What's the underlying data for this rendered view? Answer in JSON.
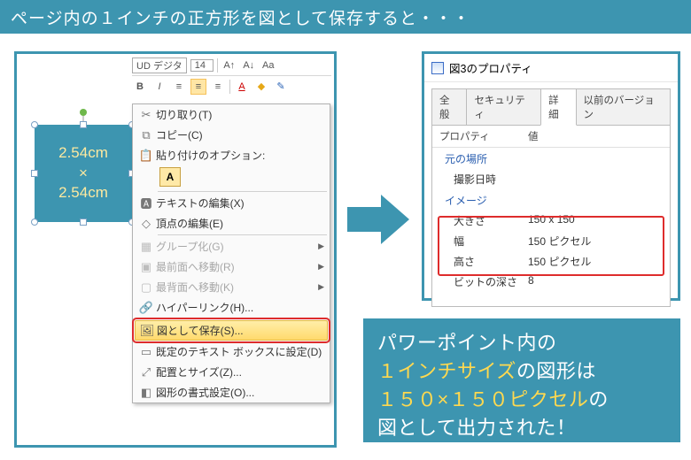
{
  "title": "ページ内の１インチの正方形を図として保存すると・・・",
  "toolbar": {
    "font_name": "UD デジタ",
    "font_size": "14"
  },
  "square": {
    "line1": "2.54cm",
    "line2": "×",
    "line3": "2.54cm"
  },
  "ctx": {
    "cut": "切り取り(T)",
    "copy": "コピー(C)",
    "paste_label": "貼り付けのオプション:",
    "paste_opt": "A",
    "edit_text": "テキストの編集(X)",
    "edit_points": "頂点の編集(E)",
    "group": "グループ化(G)",
    "bring_front": "最前面へ移動(R)",
    "send_back": "最背面へ移動(K)",
    "hyperlink": "ハイパーリンク(H)...",
    "save_as_pic": "図として保存(S)...",
    "default_textbox": "既定のテキスト ボックスに設定(D)",
    "size_pos": "配置とサイズ(Z)...",
    "format_shape": "図形の書式設定(O)..."
  },
  "props": {
    "win_title": "図3のプロパティ",
    "tabs": {
      "general": "全般",
      "security": "セキュリティ",
      "details": "詳細",
      "prev": "以前のバージョン"
    },
    "head_prop": "プロパティ",
    "head_val": "値",
    "grp_origin": "元の場所",
    "shot_date": "撮影日時",
    "grp_image": "イメージ",
    "size_label": "大きさ",
    "size_val": "150 x 150",
    "width_label": "幅",
    "width_val": "150 ピクセル",
    "height_label": "高さ",
    "height_val": "150 ピクセル",
    "bitdepth_label": "ビットの深さ",
    "bitdepth_val": "8"
  },
  "concl": {
    "l1a": "パワーポイント内の",
    "l2a": "１インチサイズ",
    "l2b": "の図形は",
    "l3a": "１５０×１５０ピクセル",
    "l3b": "の",
    "l4": "図として出力された！"
  }
}
